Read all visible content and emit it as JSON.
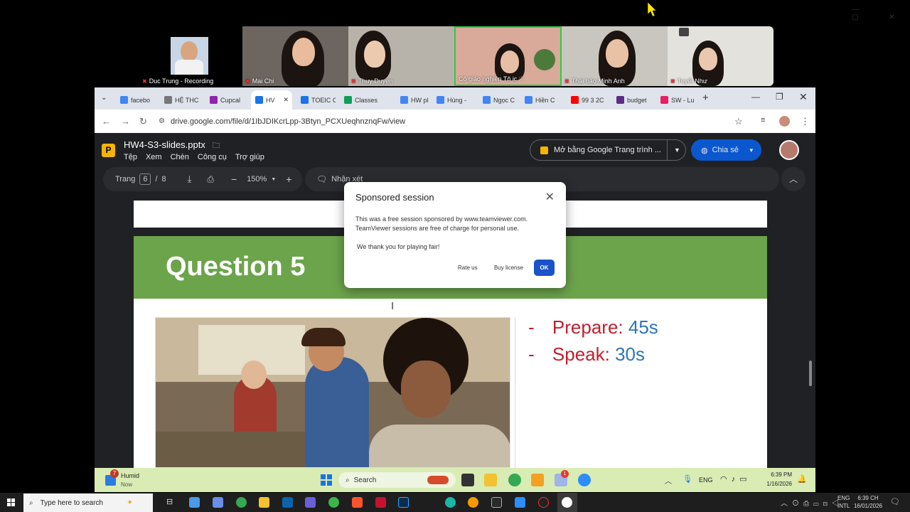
{
  "zoom": {
    "participants": [
      {
        "name": "Duc Trung - Recording"
      },
      {
        "name": "Mai Chi"
      },
      {
        "name": "Thuy Duyen"
      },
      {
        "name": "Cô giáo nghiện Tô ic ♡"
      },
      {
        "name": "Thái bảo Minh Anh"
      },
      {
        "name": "Tuyết Như"
      }
    ]
  },
  "browser": {
    "tabs": [
      {
        "label": "facebo",
        "color": "#4285f4"
      },
      {
        "label": "HỆ THC",
        "color": "#777777"
      },
      {
        "label": "Cupcal",
        "color": "#8e24aa"
      },
      {
        "label": "HV",
        "color": "#1a73e8"
      },
      {
        "label": "TOEIC C",
        "color": "#1a73e8"
      },
      {
        "label": "Classes",
        "color": "#0f9d58"
      },
      {
        "label": "HW pla",
        "color": "#4285f4"
      },
      {
        "label": "Hùng -",
        "color": "#4285f4"
      },
      {
        "label": "Ngọc C",
        "color": "#4285f4"
      },
      {
        "label": "Hiền C",
        "color": "#4285f4"
      },
      {
        "label": "99 3 2C",
        "color": "#ff0000"
      },
      {
        "label": "budget",
        "color": "#5b2c83"
      },
      {
        "label": "SW - Lu",
        "color": "#e91e63"
      }
    ],
    "url": "drive.google.com/file/d/1IbJDIKcrLpp-3Btyn_PCXUeqhnznqFw/view"
  },
  "drive": {
    "file_icon": "P",
    "title": "HW4-S3-slides.pptx",
    "menu": [
      "Tệp",
      "Xem",
      "Chèn",
      "Công cụ",
      "Trợ giúp"
    ],
    "open_with": "Mở bằng Google Trang trình ...",
    "share": "Chia sẻ",
    "page_label": "Trang",
    "page_current": "6",
    "page_sep": "/",
    "page_total": "8",
    "zoom": "150%",
    "comment": "Nhận xét"
  },
  "slide": {
    "heading": "Question 5",
    "bullets": [
      {
        "dash": "-",
        "label": "Prepare:",
        "value": "45s"
      },
      {
        "dash": "-",
        "label": "Speak:",
        "value": "30s"
      }
    ]
  },
  "dialog": {
    "title": "Sponsored session",
    "message": "This was a free session sponsored by www.teamviewer.com. TeamViewer sessions are free of charge for personal use.",
    "thanks": "We thank you for playing fair!",
    "rate": "Rate us",
    "buy": "Buy license",
    "ok": "OK"
  },
  "inner_taskbar": {
    "weather_badge": "7",
    "weather_title": "Humid",
    "weather_sub": "Now",
    "search": "Search",
    "lang": "ENG",
    "time": "6:39 PM",
    "date": "1/16/2026",
    "badge": "1"
  },
  "host_taskbar": {
    "search": "Type here to search",
    "lang1": "ENG",
    "lang2": "INTL",
    "time": "6:39 CH",
    "date": "16/01/2026"
  }
}
